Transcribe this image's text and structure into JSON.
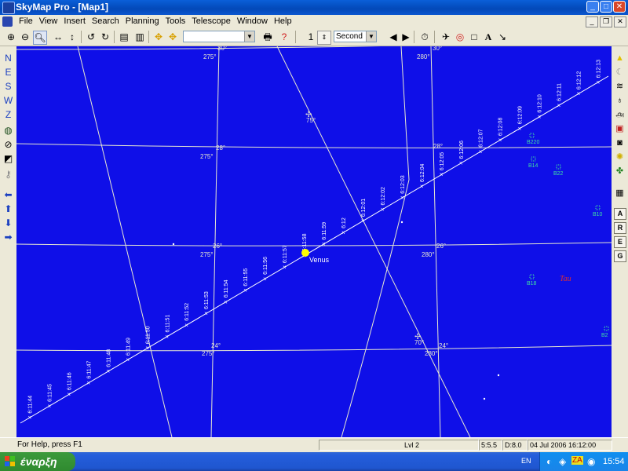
{
  "window": {
    "title": "SkyMap Pro - [Map1]",
    "buttons": {
      "minimize": "_",
      "maximize": "□",
      "close": "✕"
    }
  },
  "menu": {
    "items": [
      "File",
      "View",
      "Insert",
      "Search",
      "Planning",
      "Tools",
      "Telescope",
      "Window",
      "Help"
    ]
  },
  "toolbar": {
    "step_value": "1",
    "time_unit": "Second",
    "search_value": ""
  },
  "left_toolbar": {
    "directions": [
      "N",
      "E",
      "S",
      "W",
      "Z"
    ]
  },
  "right_toolbar": {
    "letters": [
      "A",
      "R",
      "E",
      "G"
    ]
  },
  "map": {
    "ra_labels": [
      "275°",
      "280°"
    ],
    "dec_labels": [
      "30°",
      "28°",
      "26°",
      "24°"
    ],
    "horizon_labels": [
      "75°",
      "70°"
    ],
    "planet": "Venus",
    "star_label": "Tau",
    "track_times": [
      "6:11:44",
      "6:11:45",
      "6:11:46",
      "6:11:47",
      "6:11:48",
      "6:11:49",
      "6:11:50",
      "6:11:51",
      "6:11:52",
      "6:11:53",
      "6:11:54",
      "6:11:55",
      "6:11:56",
      "6:11:57",
      "6:11:58",
      "6:11:59",
      "6:12",
      "6:12:01",
      "6:12:02",
      "6:12:03",
      "6:12:04",
      "6:12:05",
      "6:12:06",
      "6:12:07",
      "6:12:08",
      "6:12:09",
      "6:12:10",
      "6:12:11",
      "6:12:12",
      "6:12:13"
    ],
    "deep_sky": [
      "B220",
      "B14",
      "B22",
      "B10",
      "B18",
      "B2"
    ],
    "colors": {
      "background": "#0f0fe8",
      "grid": "#e8e8d0",
      "track": "#ffffff",
      "planet": "#ffff00",
      "dso": "#40e0a0",
      "star": "#e03030"
    }
  },
  "status": {
    "help": "For Help, press F1",
    "level": "Lvl 2",
    "mag": "5:5.5",
    "depth": "D:8.0",
    "datetime": "04 Jul 2006 16:12:00"
  },
  "taskbar": {
    "start": "έναρξη",
    "lang": "EN",
    "clock": "15:54"
  }
}
